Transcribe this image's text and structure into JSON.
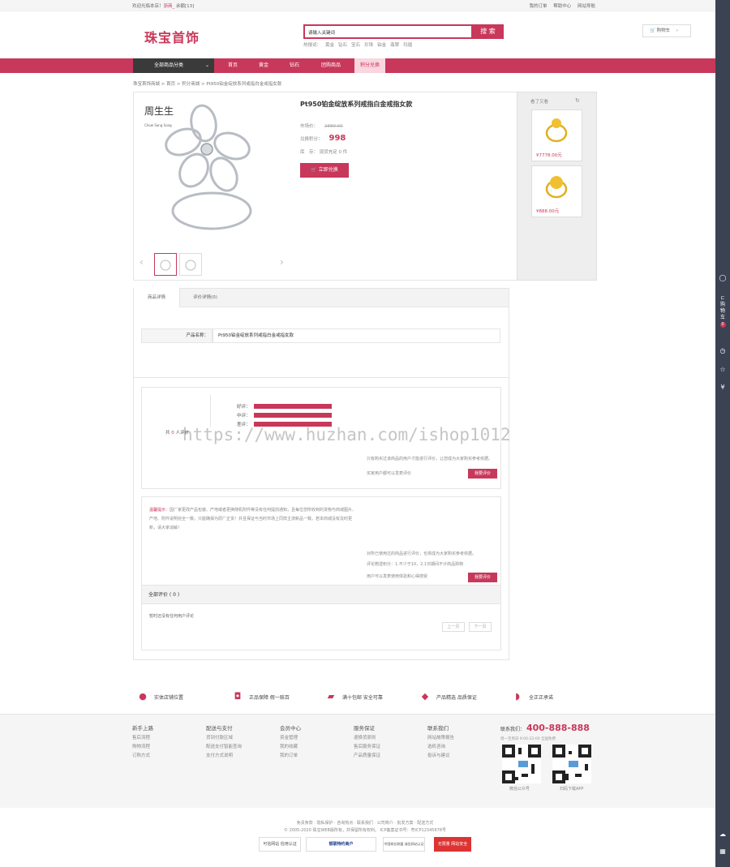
{
  "topbar": {
    "welcome": "欢迎光临本店！",
    "user": "浙商_",
    "balance": "余额[13]",
    "orders": "我的订单",
    "help": "帮助中心",
    "nav": "网站导航"
  },
  "logo": "珠宝首饰",
  "search": {
    "value": "请输入关键词",
    "button": "搜 索",
    "hot_label": "热搜词：",
    "hot": [
      "黄金",
      "钻石",
      "宝石",
      "珍珠",
      "铂金",
      "翡翠",
      "玛瑙"
    ]
  },
  "cart": "购物车",
  "nav": {
    "category": "全部商品分类",
    "items": [
      "首页",
      "黄金",
      "钻石",
      "团购商品",
      "积分兑换"
    ]
  },
  "breadcrumb": "珠宝首饰商城 > 首页 > 积分商城 > Pt950铂金绽放系列戒指白金戒指女款",
  "product": {
    "brand": "周生生",
    "brand_en": "Chow Sang Sang",
    "title": "Pt950铂金绽放系列戒指白金戒指女款",
    "market_label": "市场价：",
    "market_price": "2889.00",
    "points_label": "兑换积分：",
    "points": "998",
    "stock_label": "库　存：",
    "stock": "现货充足 0 件",
    "redeem": "立即兑换"
  },
  "side": {
    "title": "看了又看",
    "items": [
      {
        "price": "¥7778.00元"
      },
      {
        "price": "¥888.00元"
      }
    ]
  },
  "tabs": [
    "商品详情",
    "评价详情(0)"
  ],
  "detail": {
    "name_label": "产品名称：",
    "name_value": "Pt950铂金绽放系列戒指白金戒指女款"
  },
  "review": {
    "good": "好评：",
    "mid": "中评：",
    "bad": "差评：",
    "total_label": "共",
    "total_count": "0",
    "total_suffix": "人评价",
    "tip1": "只有购买过该商品的用户才能进行评价，让您成为大家购买参考依据。",
    "tip2": "买家用户都可以发表评价",
    "btn": "我要评价"
  },
  "tip": {
    "label": "温馨提示：",
    "text": "因厂家更改产品包装、产地或者更换随机附件等没有任何提前通知，且每位您所收到的货物与商城图片、产地、附件说明完全一致。只能确保为原厂正货！并且保证与当时市场上同样主流新品一致。若本商城没有及时更新，请大家谅解！",
    "r1": "对所已使用过的商品进行评价，也将成为大家购买参考依据。",
    "r2": "评论赠送积分：1.不少于10，2.1日期间不计商品购物",
    "r3": "用户可以发表使用体验和心得感受",
    "btn": "我要评价"
  },
  "all_reviews": {
    "title": "全部评价 ( 0 )",
    "empty": "暂时还没有任何用户评论",
    "prev": "上一页",
    "next": "下一页"
  },
  "services": [
    "实体店铺位置",
    "正品保障 假一赔百",
    "满十包邮 安全可靠",
    "产品精选 品质保证",
    "全正正承诺"
  ],
  "footer": {
    "cols": [
      {
        "h": "新手上路",
        "items": [
          "售后流程",
          "购物流程",
          "订购方式"
        ]
      },
      {
        "h": "配送与支付",
        "items": [
          "货到付款区域",
          "配送支付智能查询",
          "支付方式说明"
        ]
      },
      {
        "h": "会员中心",
        "items": [
          "资金管理",
          "我的收藏",
          "我的订单"
        ]
      },
      {
        "h": "服务保证",
        "items": [
          "退换货原则",
          "售后服务保证",
          "产品质量保证"
        ]
      },
      {
        "h": "联系我们",
        "items": [
          "网站故障报告",
          "选机咨询",
          "投诉与建议"
        ]
      }
    ],
    "contact_label": "联系我们：",
    "tel": "400-888-888",
    "hours": "周一至周日 9:00-22:00 全国免费",
    "qr1": "微信公众号",
    "qr2": "扫码下载APP",
    "links": "免责条款 · 隐私保护 · 咨询热点 · 联系我们 · 公司简介 · 批发方案 · 配送方式",
    "copyright": "© 2005-2020 珠宝WEB版所有，并保留所有权利。 ICP备案证书号：粤ICP12345678号",
    "badges": [
      "可信网站 信用认证",
      "银联特约商户",
      "中国商业联盟 诚信网站认证",
      "无限量 网站安全"
    ]
  },
  "watermark": "https://www.huzhan.com/ishop1012",
  "colors": {
    "accent": "#c8385a",
    "dark": "#3a3a3a"
  }
}
